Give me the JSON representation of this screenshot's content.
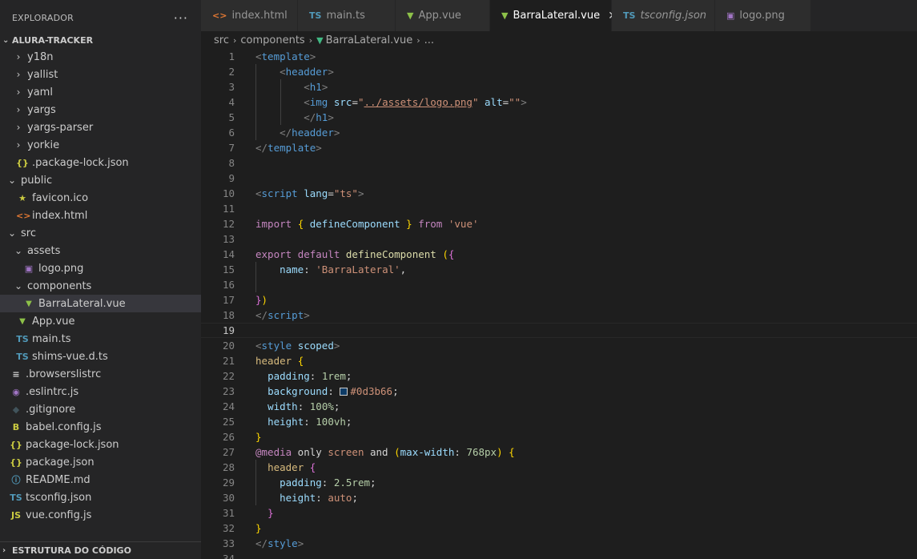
{
  "sidebar": {
    "title": "EXPLORADOR",
    "more": "···",
    "project": "ALURA-TRACKER",
    "outline": "ESTRUTURA DO CÓDIGO",
    "items": [
      {
        "label": "y18n",
        "depth": 1,
        "kind": "folder",
        "open": false
      },
      {
        "label": "yallist",
        "depth": 1,
        "kind": "folder",
        "open": false
      },
      {
        "label": "yaml",
        "depth": 1,
        "kind": "folder",
        "open": false
      },
      {
        "label": "yargs",
        "depth": 1,
        "kind": "folder",
        "open": false
      },
      {
        "label": "yargs-parser",
        "depth": 1,
        "kind": "folder",
        "open": false
      },
      {
        "label": "yorkie",
        "depth": 1,
        "kind": "folder",
        "open": false
      },
      {
        "label": ".package-lock.json",
        "depth": 1,
        "kind": "json"
      },
      {
        "label": "public",
        "depth": 0,
        "kind": "folder",
        "open": true
      },
      {
        "label": "favicon.ico",
        "depth": 1,
        "kind": "star"
      },
      {
        "label": "index.html",
        "depth": 1,
        "kind": "html"
      },
      {
        "label": "src",
        "depth": 0,
        "kind": "folder",
        "open": true
      },
      {
        "label": "assets",
        "depth": 1,
        "kind": "folder",
        "open": true
      },
      {
        "label": "logo.png",
        "depth": 2,
        "kind": "image"
      },
      {
        "label": "components",
        "depth": 1,
        "kind": "folder",
        "open": true
      },
      {
        "label": "BarraLateral.vue",
        "depth": 2,
        "kind": "vue",
        "selected": true
      },
      {
        "label": "App.vue",
        "depth": 1,
        "kind": "vue"
      },
      {
        "label": "main.ts",
        "depth": 1,
        "kind": "ts"
      },
      {
        "label": "shims-vue.d.ts",
        "depth": 1,
        "kind": "ts"
      },
      {
        "label": ".browserslistrc",
        "depth": 0,
        "kind": "lines"
      },
      {
        "label": ".eslintrc.js",
        "depth": 0,
        "kind": "eslint"
      },
      {
        "label": ".gitignore",
        "depth": 0,
        "kind": "git"
      },
      {
        "label": "babel.config.js",
        "depth": 0,
        "kind": "babel"
      },
      {
        "label": "package-lock.json",
        "depth": 0,
        "kind": "json"
      },
      {
        "label": "package.json",
        "depth": 0,
        "kind": "json"
      },
      {
        "label": "README.md",
        "depth": 0,
        "kind": "info"
      },
      {
        "label": "tsconfig.json",
        "depth": 0,
        "kind": "tsconfig"
      },
      {
        "label": "vue.config.js",
        "depth": 0,
        "kind": "js"
      }
    ]
  },
  "icons": {
    "folder": {
      "glyph": "",
      "color": "#cccccc"
    },
    "json": {
      "glyph": "{}",
      "color": "#cbcb41"
    },
    "star": {
      "glyph": "★",
      "color": "#cbcb41"
    },
    "html": {
      "glyph": "<>",
      "color": "#e37933"
    },
    "image": {
      "glyph": "▣",
      "color": "#a074c4"
    },
    "vue": {
      "glyph": "▼",
      "color": "#8dc149"
    },
    "ts": {
      "glyph": "TS",
      "color": "#519aba"
    },
    "lines": {
      "glyph": "≡",
      "color": "#cccccc"
    },
    "eslint": {
      "glyph": "◉",
      "color": "#a074c4"
    },
    "git": {
      "glyph": "◆",
      "color": "#41535b"
    },
    "babel": {
      "glyph": "B",
      "color": "#cbcb41"
    },
    "info": {
      "glyph": "ⓘ",
      "color": "#519aba"
    },
    "tsconfig": {
      "glyph": "TS",
      "color": "#519aba"
    },
    "js": {
      "glyph": "JS",
      "color": "#cbcb41"
    }
  },
  "tabs": [
    {
      "label": "index.html",
      "kind": "html",
      "width": 121
    },
    {
      "label": "main.ts",
      "kind": "ts",
      "width": 122
    },
    {
      "label": "App.vue",
      "kind": "vue",
      "width": 118
    },
    {
      "label": "BarraLateral.vue",
      "kind": "vue",
      "active": true,
      "close": "✕",
      "width": 152
    },
    {
      "label": "tsconfig.json",
      "kind": "tsconfig",
      "italic": true,
      "width": 129
    },
    {
      "label": "logo.png",
      "kind": "image",
      "width": 120
    }
  ],
  "breadcrumb": [
    "src",
    "components",
    "BarraLateral.vue",
    "..."
  ],
  "editor": {
    "current_line": 19,
    "lines": [
      [
        [
          "t-tag",
          "<"
        ],
        [
          "t-tn",
          "template"
        ],
        [
          "t-tag",
          ">"
        ]
      ],
      [
        [
          "",
          "    "
        ],
        [
          "t-tag",
          "<"
        ],
        [
          "t-tn",
          "headder"
        ],
        [
          "t-tag",
          ">"
        ]
      ],
      [
        [
          "",
          "        "
        ],
        [
          "t-tag",
          "<"
        ],
        [
          "t-tn",
          "h1"
        ],
        [
          "t-tag",
          ">"
        ]
      ],
      [
        [
          "",
          "        "
        ],
        [
          "t-tag",
          "<"
        ],
        [
          "t-tn",
          "img"
        ],
        [
          "t-txt",
          " "
        ],
        [
          "t-attr",
          "src"
        ],
        [
          "t-txt",
          "="
        ],
        [
          "t-str",
          "\""
        ],
        [
          "t-str link",
          "../assets/logo.png"
        ],
        [
          "t-str",
          "\""
        ],
        [
          "t-txt",
          " "
        ],
        [
          "t-attr",
          "alt"
        ],
        [
          "t-txt",
          "="
        ],
        [
          "t-str",
          "\"\""
        ],
        [
          "t-tag",
          ">"
        ]
      ],
      [
        [
          "",
          "        "
        ],
        [
          "t-tag",
          "</"
        ],
        [
          "t-tn",
          "h1"
        ],
        [
          "t-tag",
          ">"
        ]
      ],
      [
        [
          "",
          "    "
        ],
        [
          "t-tag",
          "</"
        ],
        [
          "t-tn",
          "headder"
        ],
        [
          "t-tag",
          ">"
        ]
      ],
      [
        [
          "t-tag",
          "</"
        ],
        [
          "t-tn",
          "template"
        ],
        [
          "t-tag",
          ">"
        ]
      ],
      [],
      [],
      [
        [
          "t-tag",
          "<"
        ],
        [
          "t-tn",
          "script"
        ],
        [
          "t-txt",
          " "
        ],
        [
          "t-attr",
          "lang"
        ],
        [
          "t-txt",
          "="
        ],
        [
          "t-str",
          "\"ts\""
        ],
        [
          "t-tag",
          ">"
        ]
      ],
      [],
      [
        [
          "t-kw",
          "import"
        ],
        [
          "t-txt",
          " "
        ],
        [
          "t-br1",
          "{"
        ],
        [
          "t-txt",
          " "
        ],
        [
          "t-attr",
          "defineComponent"
        ],
        [
          "t-txt",
          " "
        ],
        [
          "t-br1",
          "}"
        ],
        [
          "t-txt",
          " "
        ],
        [
          "t-kw",
          "from"
        ],
        [
          "t-txt",
          " "
        ],
        [
          "t-str",
          "'vue'"
        ]
      ],
      [],
      [
        [
          "t-kw",
          "export"
        ],
        [
          "t-txt",
          " "
        ],
        [
          "t-kw",
          "default"
        ],
        [
          "t-txt",
          " "
        ],
        [
          "t-fn",
          "defineComponent"
        ],
        [
          "t-txt",
          " "
        ],
        [
          "t-br1",
          "("
        ],
        [
          "t-br2",
          "{"
        ]
      ],
      [
        [
          "",
          "    "
        ],
        [
          "t-attr",
          "name"
        ],
        [
          "t-txt",
          ": "
        ],
        [
          "t-str",
          "'BarraLateral'"
        ],
        [
          "t-txt",
          ","
        ]
      ],
      [],
      [
        [
          "t-br2",
          "}"
        ],
        [
          "t-br1",
          ")"
        ]
      ],
      [
        [
          "t-tag",
          "</"
        ],
        [
          "t-tn",
          "script"
        ],
        [
          "t-tag",
          ">"
        ]
      ],
      [],
      [
        [
          "t-tag",
          "<"
        ],
        [
          "t-tn",
          "style"
        ],
        [
          "t-txt",
          " "
        ],
        [
          "t-attr",
          "scoped"
        ],
        [
          "t-tag",
          ">"
        ]
      ],
      [
        [
          "t-sel",
          "header"
        ],
        [
          "t-txt",
          " "
        ],
        [
          "t-br1",
          "{"
        ]
      ],
      [
        [
          "",
          "  "
        ],
        [
          "t-prop",
          "padding"
        ],
        [
          "t-txt",
          ": "
        ],
        [
          "t-num",
          "1rem"
        ],
        [
          "t-txt",
          ";"
        ]
      ],
      [
        [
          "",
          "  "
        ],
        [
          "t-prop",
          "background"
        ],
        [
          "t-txt",
          ": "
        ],
        [
          "swatch",
          ""
        ],
        [
          "t-str",
          "#0d3b66"
        ],
        [
          "t-txt",
          ";"
        ]
      ],
      [
        [
          "",
          "  "
        ],
        [
          "t-prop",
          "width"
        ],
        [
          "t-txt",
          ": "
        ],
        [
          "t-num",
          "100%"
        ],
        [
          "t-txt",
          ";"
        ]
      ],
      [
        [
          "",
          "  "
        ],
        [
          "t-prop",
          "height"
        ],
        [
          "t-txt",
          ": "
        ],
        [
          "t-num",
          "100vh"
        ],
        [
          "t-txt",
          ";"
        ]
      ],
      [
        [
          "t-br1",
          "}"
        ]
      ],
      [
        [
          "t-at",
          "@media"
        ],
        [
          "t-txt",
          " only "
        ],
        [
          "t-str",
          "screen"
        ],
        [
          "t-txt",
          " and "
        ],
        [
          "t-br1",
          "("
        ],
        [
          "t-prop",
          "max-width"
        ],
        [
          "t-txt",
          ": "
        ],
        [
          "t-num",
          "768px"
        ],
        [
          "t-br1",
          ")"
        ],
        [
          "t-txt",
          " "
        ],
        [
          "t-br1",
          "{"
        ]
      ],
      [
        [
          "",
          "  "
        ],
        [
          "t-sel",
          "header"
        ],
        [
          "t-txt",
          " "
        ],
        [
          "t-br2",
          "{"
        ]
      ],
      [
        [
          "",
          "    "
        ],
        [
          "t-prop",
          "padding"
        ],
        [
          "t-txt",
          ": "
        ],
        [
          "t-num",
          "2.5rem"
        ],
        [
          "t-txt",
          ";"
        ]
      ],
      [
        [
          "",
          "    "
        ],
        [
          "t-prop",
          "height"
        ],
        [
          "t-txt",
          ": "
        ],
        [
          "t-str",
          "auto"
        ],
        [
          "t-txt",
          ";"
        ]
      ],
      [
        [
          "",
          "  "
        ],
        [
          "t-br2",
          "}"
        ]
      ],
      [
        [
          "t-br1",
          "}"
        ]
      ],
      [
        [
          "t-tag",
          "</"
        ],
        [
          "t-tn",
          "style"
        ],
        [
          "t-tag",
          ">"
        ]
      ],
      []
    ]
  }
}
